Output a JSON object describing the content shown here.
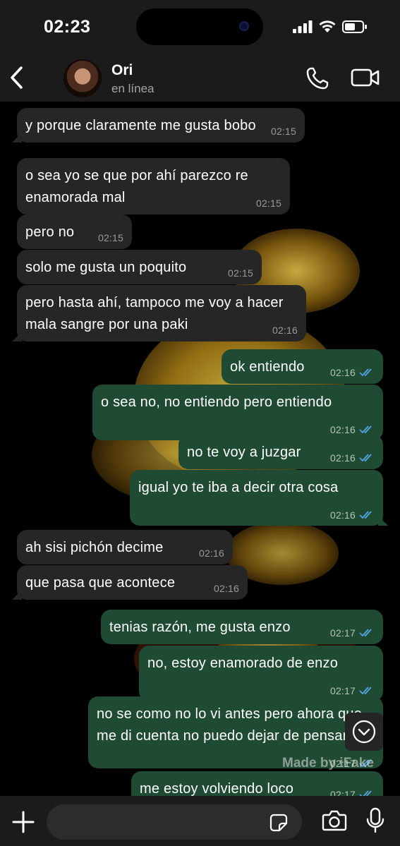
{
  "status_bar": {
    "time": "02:23"
  },
  "header": {
    "back_icon": "chevron-left-icon",
    "name": "Ori",
    "status": "en línea",
    "call_icon": "phone-icon",
    "video_icon": "video-camera-icon"
  },
  "messages": [
    {
      "dir": "in",
      "text": "y porque claramente me gusta bobo",
      "time": "02:15"
    },
    {
      "dir": "in",
      "text": "o sea yo se que por ahí parezco re enamorada mal",
      "time": "02:15"
    },
    {
      "dir": "in",
      "text": "pero no",
      "time": "02:15"
    },
    {
      "dir": "in",
      "text": "solo me gusta un poquito",
      "time": "02:15"
    },
    {
      "dir": "in",
      "text": "pero hasta ahí, tampoco me voy a hacer mala sangre por una paki",
      "time": "02:16"
    },
    {
      "dir": "out",
      "text": "ok entiendo",
      "time": "02:16"
    },
    {
      "dir": "out",
      "text": "o sea no, no entiendo pero entiendo",
      "time": "02:16"
    },
    {
      "dir": "out",
      "text": "no te voy a juzgar",
      "time": "02:16"
    },
    {
      "dir": "out",
      "text": "igual yo te iba a decir otra cosa",
      "time": "02:16"
    },
    {
      "dir": "in",
      "text": "ah sisi pichón decime",
      "time": "02:16"
    },
    {
      "dir": "in",
      "text": "que pasa que acontece",
      "time": "02:16"
    },
    {
      "dir": "out",
      "text": "tenias razón, me gusta enzo",
      "time": "02:17"
    },
    {
      "dir": "out",
      "text": "no, estoy enamorado de enzo",
      "time": "02:17"
    },
    {
      "dir": "out",
      "text": "no se como no lo vi antes pero ahora que me di cuenta no puedo dejar de pensarlo",
      "time": "02:17"
    },
    {
      "dir": "out",
      "text": "me estoy volviendo loco",
      "time": "02:17"
    }
  ],
  "watermark": "Made by iFake",
  "composer": {
    "placeholder": "",
    "plus_icon": "plus-icon",
    "sticker_icon": "sticker-icon",
    "camera_icon": "camera-icon",
    "mic_icon": "microphone-icon"
  },
  "colors": {
    "incoming": "#262626",
    "outgoing": "#1f4a33",
    "read_ticks": "#53a6e6"
  }
}
